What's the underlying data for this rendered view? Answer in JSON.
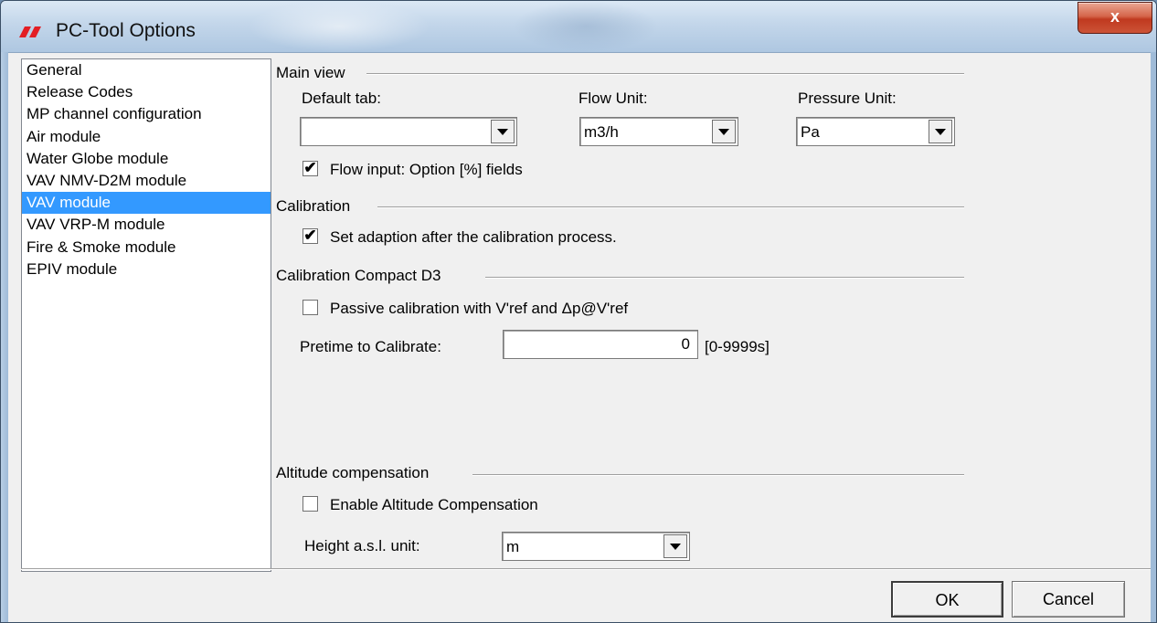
{
  "window": {
    "title": "PC-Tool Options",
    "close_label": "x"
  },
  "sidebar": {
    "items": [
      {
        "label": "General",
        "selected": false
      },
      {
        "label": "Release Codes",
        "selected": false
      },
      {
        "label": "MP channel configuration",
        "selected": false
      },
      {
        "label": "Air module",
        "selected": false
      },
      {
        "label": "Water Globe module",
        "selected": false
      },
      {
        "label": "VAV NMV-D2M module",
        "selected": false
      },
      {
        "label": "VAV module",
        "selected": true
      },
      {
        "label": "VAV VRP-M module",
        "selected": false
      },
      {
        "label": "Fire & Smoke module",
        "selected": false
      },
      {
        "label": "EPIV module",
        "selected": false
      }
    ]
  },
  "main_view": {
    "title": "Main view",
    "default_tab": {
      "label": "Default tab:",
      "value": ""
    },
    "flow_unit": {
      "label": "Flow Unit:",
      "value": "m3/h"
    },
    "pressure_unit": {
      "label": "Pressure Unit:",
      "value": "Pa"
    },
    "flow_input_option": {
      "label": "Flow input: Option [%] fields",
      "checked": true
    }
  },
  "calibration": {
    "title": "Calibration",
    "set_adaption": {
      "label": "Set adaption after the calibration process.",
      "checked": true
    }
  },
  "calibration_compact_d3": {
    "title": "Calibration Compact D3",
    "passive_calibration": {
      "label": "Passive calibration with V'ref and Δp@V'ref",
      "checked": false
    },
    "pretime": {
      "label": "Pretime to Calibrate:",
      "value": "0",
      "range": "[0-9999s]"
    }
  },
  "altitude": {
    "title": "Altitude compensation",
    "enable": {
      "label": "Enable Altitude Compensation",
      "checked": false
    },
    "height_unit": {
      "label": "Height a.s.l. unit:",
      "value": "m"
    }
  },
  "buttons": {
    "ok": "OK",
    "cancel": "Cancel"
  },
  "colors": {
    "selection": "#3399ff",
    "dialog_bg": "#f0f0f0",
    "close_button": "#c0391f"
  }
}
